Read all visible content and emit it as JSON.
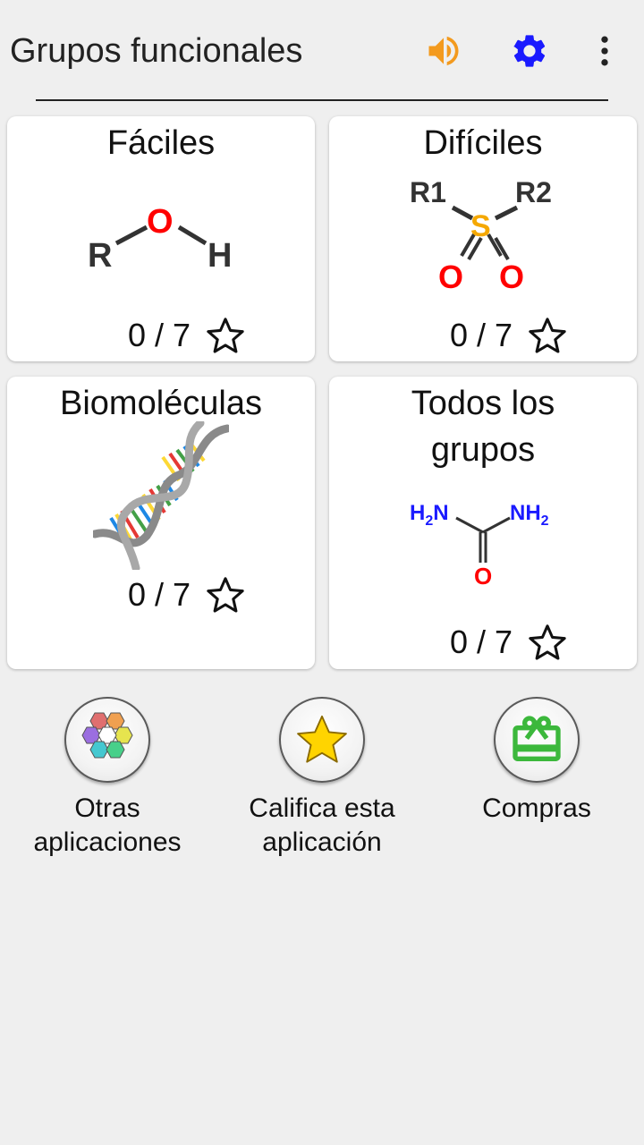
{
  "header": {
    "title": "Grupos funcionales",
    "sound_icon": "speaker-icon",
    "settings_icon": "gear-icon",
    "menu_icon": "more-vert-icon",
    "colors": {
      "sound": "#f39a1e",
      "settings": "#1a1aff"
    }
  },
  "cards": [
    {
      "title": "Fáciles",
      "score": "0 / 7",
      "image": "alcohol-formula"
    },
    {
      "title": "Difíciles",
      "score": "0 / 7",
      "image": "sulfone-formula"
    },
    {
      "title": "Biomoléculas",
      "score": "0 / 7",
      "image": "dna-helix"
    },
    {
      "title_line1": "Todos los",
      "title_line2": "grupos",
      "score": "0 / 7",
      "image": "urea-formula"
    }
  ],
  "formulas": {
    "alcohol": {
      "r": "R",
      "o": "O",
      "h": "H"
    },
    "sulfone": {
      "r1": "R1",
      "r2": "R2",
      "s": "S",
      "o": "O"
    },
    "urea": {
      "nh2": "NH",
      "sub": "2",
      "h2n_h": "H",
      "h2n_n": "N",
      "o": "O"
    }
  },
  "actions": [
    {
      "label_line1": "Otras",
      "label_line2": "aplicaciones",
      "icon": "hexagons-icon"
    },
    {
      "label_line1": "Califica esta",
      "label_line2": "aplicación",
      "icon": "star-icon"
    },
    {
      "label_line1": "Compras",
      "label_line2": "",
      "icon": "gift-icon"
    }
  ]
}
